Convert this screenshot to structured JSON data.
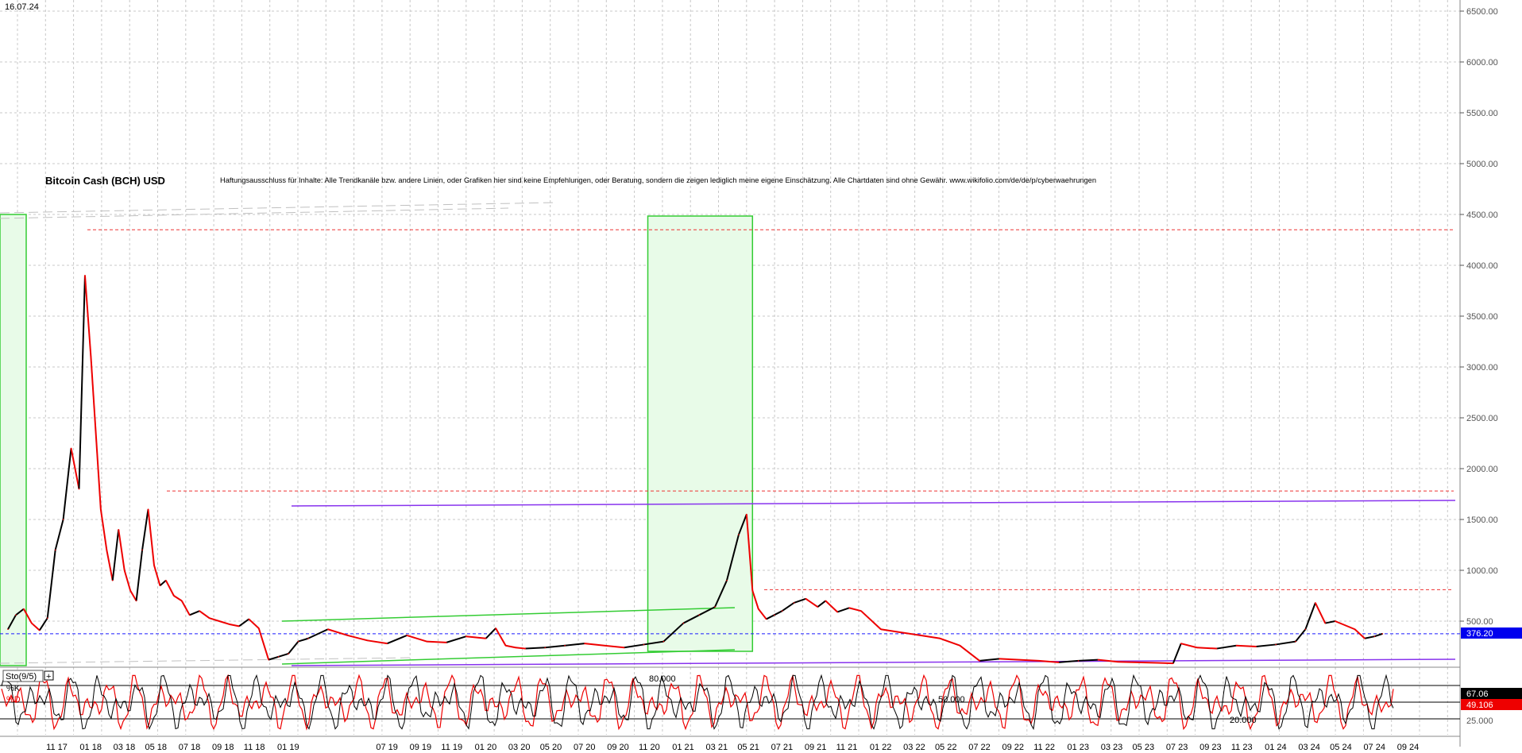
{
  "date_label": "16.07.24",
  "title": "Bitcoin Cash (BCH) USD",
  "disclaimer": "Haftungsausschluss für Inhalte: Alle Trendkanäle bzw. andere Linien, oder Grafiken hier sind keine Empfehlungen, oder Beratung, sondern die zeigen lediglich meine eigene Einschätzung. Alle Chartdaten sind ohne Gewähr.  www.wikifolio.com/de/de/p/cyberwaehrungen",
  "indicator": {
    "label": "Sto(9/5)",
    "k_label": "%K",
    "d_label": "%D",
    "level_80": "80.000",
    "level_50": "50.000",
    "level_20": "20.000",
    "axis_25": "25.000",
    "k_value": "67.06",
    "d_value": "49.106"
  },
  "colors": {
    "price_up": "#000000",
    "price_down": "#ee0000",
    "support": "#1a1aff",
    "resistance": "#ee3333",
    "trend_purple": "#8833ee",
    "trend_green": "#33cc33",
    "zone_fill": "#e8fbe8",
    "last_price_bg": "#0000ee",
    "k_bg": "#000000",
    "d_bg": "#ee0000"
  },
  "chart_data": {
    "type": "line",
    "title": "Bitcoin Cash (BCH) USD",
    "ylim": [
      0,
      6700
    ],
    "y_ticks": [
      "6500.00",
      "6000.00",
      "5500.00",
      "5000.00",
      "4500.00",
      "4000.00",
      "3500.00",
      "3000.00",
      "2500.00",
      "2000.00",
      "1500.00",
      "1000.00",
      "500.00"
    ],
    "y_tick_values": [
      6500,
      6000,
      5500,
      5000,
      4500,
      4000,
      3500,
      3000,
      2500,
      2000,
      1500,
      1000,
      500
    ],
    "x_labels": [
      "11 17",
      "01 18",
      "03 18",
      "05 18",
      "07 18",
      "09 18",
      "11 18",
      "01 19",
      "07 19",
      "09 19",
      "11 19",
      "01 20",
      "03 20",
      "05 20",
      "07 20",
      "09 20",
      "11 20",
      "01 21",
      "03 21",
      "05 21",
      "07 21",
      "09 21",
      "11 21",
      "01 22",
      "03 22",
      "05 22",
      "07 22",
      "09 22",
      "11 22",
      "01 23",
      "03 23",
      "05 23",
      "07 23",
      "09 23",
      "11 23",
      "01 24",
      "03 24",
      "05 24",
      "07 24",
      "09 24"
    ],
    "x_label_months": [
      2017.83,
      2018.0,
      2018.17,
      2018.33,
      2018.5,
      2018.67,
      2018.83,
      2019.0,
      2019.5,
      2019.67,
      2019.83,
      2020.0,
      2020.17,
      2020.33,
      2020.5,
      2020.67,
      2020.83,
      2021.0,
      2021.17,
      2021.33,
      2021.5,
      2021.67,
      2021.83,
      2022.0,
      2022.17,
      2022.33,
      2022.5,
      2022.67,
      2022.83,
      2023.0,
      2023.17,
      2023.33,
      2023.5,
      2023.67,
      2023.83,
      2024.0,
      2024.17,
      2024.33,
      2024.5,
      2024.67
    ],
    "series": [
      {
        "x": [
          2017.58,
          2017.62,
          2017.66,
          2017.7,
          2017.74,
          2017.78,
          2017.82,
          2017.86,
          2017.9,
          2017.94,
          2017.97,
          2018.0,
          2018.02,
          2018.05,
          2018.08,
          2018.11,
          2018.14,
          2018.17,
          2018.2,
          2018.23,
          2018.26,
          2018.29,
          2018.32,
          2018.35,
          2018.38,
          2018.42,
          2018.46,
          2018.5,
          2018.55,
          2018.6,
          2018.65,
          2018.7,
          2018.75,
          2018.8,
          2018.85,
          2018.9,
          2018.95,
          2019.0,
          2019.05,
          2019.1,
          2019.2,
          2019.3,
          2019.4,
          2019.5,
          2019.6,
          2019.7,
          2019.8,
          2019.9,
          2020.0,
          2020.05,
          2020.1,
          2020.15,
          2020.2,
          2020.3,
          2020.4,
          2020.5,
          2020.6,
          2020.7,
          2020.8,
          2020.9,
          2021.0,
          2021.08,
          2021.16,
          2021.22,
          2021.28,
          2021.32,
          2021.35,
          2021.38,
          2021.42,
          2021.46,
          2021.5,
          2021.56,
          2021.62,
          2021.68,
          2021.72,
          2021.78,
          2021.84,
          2021.9,
          2022.0,
          2022.1,
          2022.2,
          2022.3,
          2022.4,
          2022.5,
          2022.6,
          2022.7,
          2022.8,
          2022.9,
          2023.0,
          2023.1,
          2023.2,
          2023.3,
          2023.4,
          2023.48,
          2023.52,
          2023.6,
          2023.7,
          2023.8,
          2023.9,
          2024.0,
          2024.1,
          2024.15,
          2024.2,
          2024.25,
          2024.3,
          2024.35,
          2024.4,
          2024.45,
          2024.5,
          2024.54
        ],
        "values": [
          420,
          560,
          620,
          480,
          410,
          530,
          1200,
          1500,
          2200,
          1800,
          3900,
          3100,
          2500,
          1600,
          1200,
          900,
          1400,
          1000,
          800,
          700,
          1200,
          1600,
          1050,
          850,
          900,
          750,
          700,
          560,
          600,
          530,
          500,
          470,
          450,
          520,
          430,
          120,
          150,
          180,
          300,
          330,
          420,
          360,
          310,
          280,
          360,
          300,
          290,
          350,
          330,
          430,
          260,
          240,
          230,
          240,
          260,
          280,
          260,
          240,
          270,
          300,
          480,
          560,
          640,
          900,
          1350,
          1550,
          800,
          620,
          520,
          560,
          600,
          680,
          720,
          640,
          700,
          590,
          630,
          600,
          420,
          390,
          360,
          330,
          260,
          110,
          130,
          120,
          110,
          95,
          110,
          120,
          100,
          95,
          90,
          85,
          280,
          240,
          230,
          260,
          250,
          270,
          300,
          420,
          680,
          480,
          500,
          460,
          420,
          330,
          350,
          376
        ]
      }
    ],
    "last_price": "376.20",
    "last_price_value": 376.2,
    "support_level": 376.2,
    "resistance_levels": [
      4350,
      1780,
      810
    ]
  }
}
